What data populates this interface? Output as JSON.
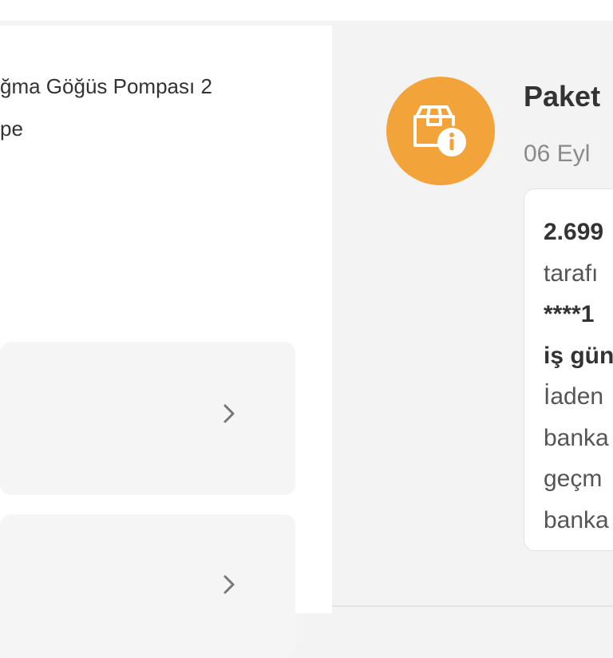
{
  "product": {
    "title_lines": [
      "ğma Göğüs Pompası 2",
      "pe"
    ]
  },
  "status": {
    "icon": "package-info-icon",
    "accent_color": "#f2a33a",
    "title": "Paket",
    "date": "06 Eyl",
    "message_lines": [
      "2.699",
      "tarafı",
      "****1",
      "iş gün",
      "İaden",
      "banka",
      "geçm",
      "banka"
    ]
  }
}
